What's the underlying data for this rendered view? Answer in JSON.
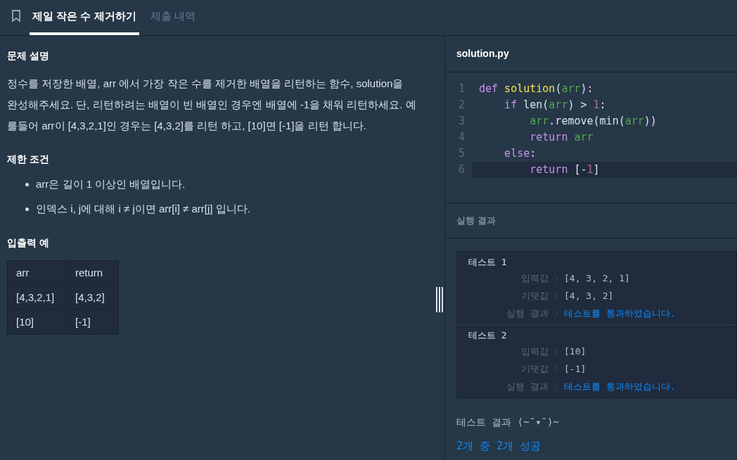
{
  "tabs": [
    {
      "label": "제일 작은 수 제거하기",
      "selected": true
    },
    {
      "label": "제출 내역",
      "selected": false
    }
  ],
  "description": {
    "heading": "문제 설명",
    "paragraph": "정수를 저장한 배열, arr 에서 가장 작은 수를 제거한 배열을 리턴하는 함수, solution을 완성해주세요. 단, 리턴하려는 배열이 빈 배열인 경우엔 배열에 -1을 채워 리턴하세요. 예를들어 arr이 [4,3,2,1]인 경우는 [4,3,2]를 리턴 하고, [10]면 [-1]을 리턴 합니다.",
    "constraints_heading": "제한 조건",
    "constraints": [
      "arr은 길이 1 이상인 배열입니다.",
      "인덱스 i, j에 대해 i ≠ j이면 arr[i] ≠ arr[j] 입니다."
    ],
    "examples_heading": "입출력 예",
    "table": {
      "columns": [
        "arr",
        "return"
      ],
      "rows": [
        [
          "[4,3,2,1]",
          "[4,3,2]"
        ],
        [
          "[10]",
          "[-1]"
        ]
      ]
    }
  },
  "editor": {
    "filename": "solution.py",
    "lines": [
      {
        "number": "1",
        "current": false,
        "tokens": [
          {
            "kind": "kw",
            "text": "def"
          },
          {
            "kind": "fn",
            "text": " solution"
          },
          {
            "kind": "plain",
            "text": "("
          },
          {
            "kind": "var",
            "text": "arr"
          },
          {
            "kind": "plain",
            "text": "):"
          }
        ]
      },
      {
        "number": "2",
        "current": false,
        "tokens": [
          {
            "kind": "kw",
            "text": "    if"
          },
          {
            "kind": "plain",
            "text": " len("
          },
          {
            "kind": "var",
            "text": "arr"
          },
          {
            "kind": "plain",
            "text": ") > "
          },
          {
            "kind": "num",
            "text": "1"
          },
          {
            "kind": "plain",
            "text": ":"
          }
        ]
      },
      {
        "number": "3",
        "current": false,
        "tokens": [
          {
            "kind": "var",
            "text": "        arr"
          },
          {
            "kind": "plain",
            "text": ".remove(min("
          },
          {
            "kind": "var",
            "text": "arr"
          },
          {
            "kind": "plain",
            "text": "))"
          }
        ]
      },
      {
        "number": "4",
        "current": false,
        "tokens": [
          {
            "kind": "kw",
            "text": "        return"
          },
          {
            "kind": "var",
            "text": " arr"
          }
        ]
      },
      {
        "number": "5",
        "current": false,
        "tokens": [
          {
            "kind": "kw",
            "text": "    else"
          },
          {
            "kind": "plain",
            "text": ":"
          }
        ]
      },
      {
        "number": "6",
        "current": true,
        "tokens": [
          {
            "kind": "kw",
            "text": "        return"
          },
          {
            "kind": "plain",
            "text": " [-"
          },
          {
            "kind": "num",
            "text": "1"
          },
          {
            "kind": "plain",
            "text": "]"
          }
        ]
      }
    ]
  },
  "results": {
    "heading": "실행 결과",
    "tests": [
      {
        "title": "테스트 1",
        "rows": [
          {
            "label": "입력값",
            "value": "[4, 3, 2, 1]",
            "kind": "value"
          },
          {
            "label": "기댓값",
            "value": "[4, 3, 2]",
            "kind": "value"
          },
          {
            "label": "실행 결과",
            "value": "테스트를 통과하였습니다.",
            "kind": "pass"
          }
        ]
      },
      {
        "title": "테스트 2",
        "rows": [
          {
            "label": "입력값",
            "value": "[10]",
            "kind": "value"
          },
          {
            "label": "기댓값",
            "value": "[-1]",
            "kind": "value"
          },
          {
            "label": "실행 결과",
            "value": "테스트를 통과하였습니다.",
            "kind": "pass"
          }
        ]
      }
    ],
    "summary_title": "테스트 결과 (~˘▾˘)~",
    "summary": "2개 중 2개 성공"
  }
}
